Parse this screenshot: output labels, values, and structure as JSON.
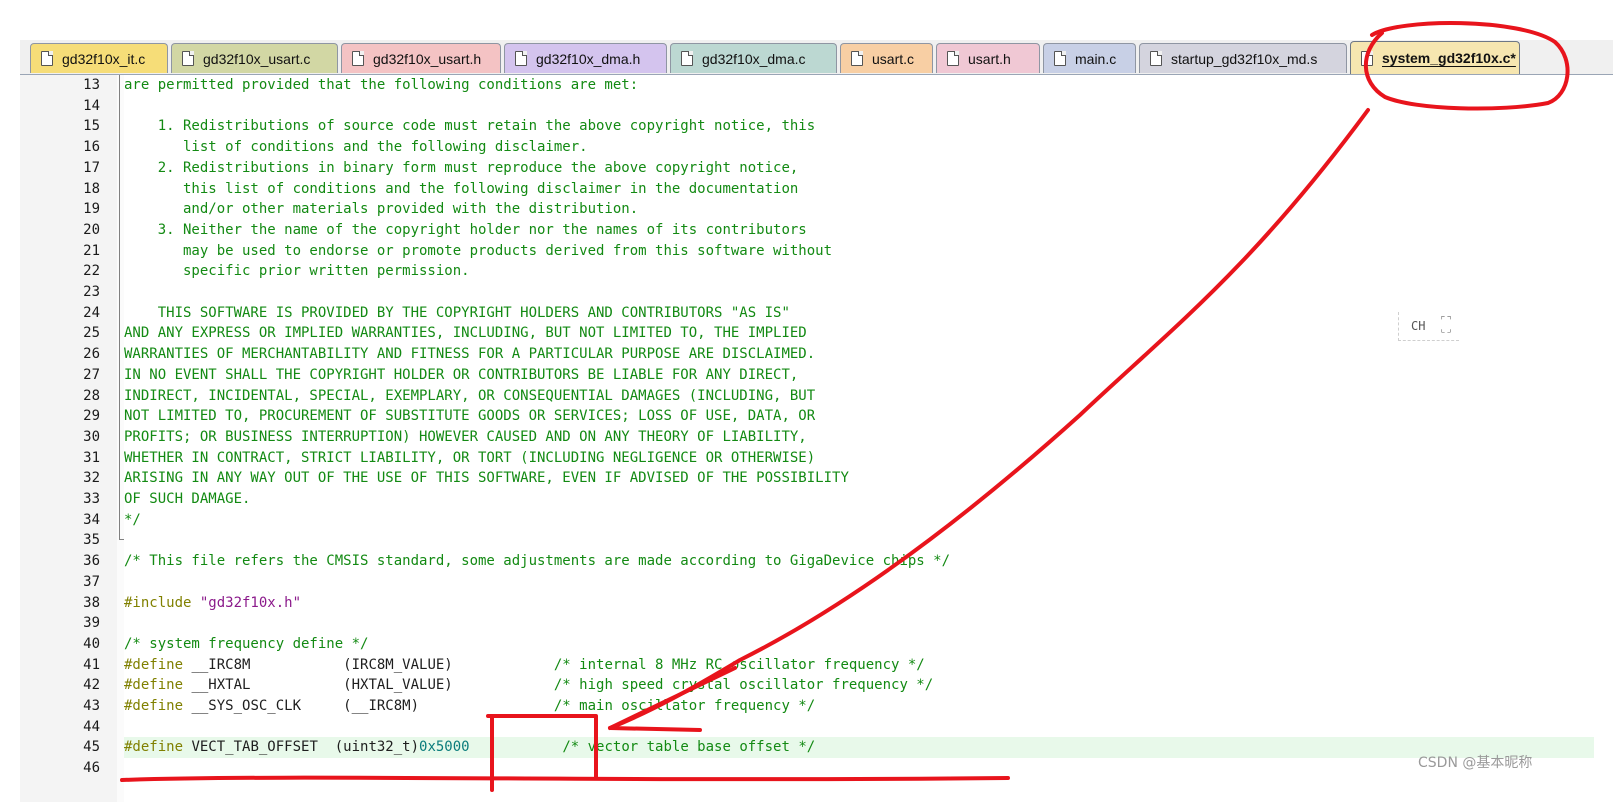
{
  "tabs": [
    {
      "label": "gd32f10x_it.c",
      "color": "#f6dd78",
      "active": false
    },
    {
      "label": "gd32f10x_usart.c",
      "color": "#d2d7a4",
      "active": false
    },
    {
      "label": "gd32f10x_usart.h",
      "color": "#f4c3c4",
      "active": false
    },
    {
      "label": "gd32f10x_dma.h",
      "color": "#d4c4ee",
      "active": false
    },
    {
      "label": "gd32f10x_dma.c",
      "color": "#bcd8d2",
      "active": false
    },
    {
      "label": "usart.c",
      "color": "#f8cfa4",
      "active": false
    },
    {
      "label": "usart.h",
      "color": "#f0c8d4",
      "active": false
    },
    {
      "label": "main.c",
      "color": "#c8d0e6",
      "active": false
    },
    {
      "label": "startup_gd32f10x_md.s",
      "color": "#d4d4de",
      "active": false
    },
    {
      "label": "system_gd32f10x.c*",
      "color": "#f6e6b0",
      "active": true
    }
  ],
  "lines": [
    {
      "num": "13",
      "parts": [
        {
          "t": "are permitted provided that the following conditions are met:",
          "c": "com"
        }
      ]
    },
    {
      "num": "14",
      "parts": []
    },
    {
      "num": "15",
      "parts": [
        {
          "t": "    1. Redistributions of source code must retain the above copyright notice, this",
          "c": "com"
        }
      ]
    },
    {
      "num": "16",
      "parts": [
        {
          "t": "       list of conditions and the following disclaimer.",
          "c": "com"
        }
      ]
    },
    {
      "num": "17",
      "parts": [
        {
          "t": "    2. Redistributions in binary form must reproduce the above copyright notice,",
          "c": "com"
        }
      ]
    },
    {
      "num": "18",
      "parts": [
        {
          "t": "       this list of conditions and the following disclaimer in the documentation",
          "c": "com"
        }
      ]
    },
    {
      "num": "19",
      "parts": [
        {
          "t": "       and/or other materials provided with the distribution.",
          "c": "com"
        }
      ]
    },
    {
      "num": "20",
      "parts": [
        {
          "t": "    3. Neither the name of the copyright holder nor the names of its contributors",
          "c": "com"
        }
      ]
    },
    {
      "num": "21",
      "parts": [
        {
          "t": "       may be used to endorse or promote products derived from this software without",
          "c": "com"
        }
      ]
    },
    {
      "num": "22",
      "parts": [
        {
          "t": "       specific prior written permission.",
          "c": "com"
        }
      ]
    },
    {
      "num": "23",
      "parts": []
    },
    {
      "num": "24",
      "parts": [
        {
          "t": "    THIS SOFTWARE IS PROVIDED BY THE COPYRIGHT HOLDERS AND CONTRIBUTORS \"AS IS\"",
          "c": "com"
        }
      ]
    },
    {
      "num": "25",
      "parts": [
        {
          "t": "AND ANY EXPRESS OR IMPLIED WARRANTIES, INCLUDING, BUT NOT LIMITED TO, THE IMPLIED",
          "c": "com"
        }
      ]
    },
    {
      "num": "26",
      "parts": [
        {
          "t": "WARRANTIES OF MERCHANTABILITY AND FITNESS FOR A PARTICULAR PURPOSE ARE DISCLAIMED.",
          "c": "com"
        }
      ]
    },
    {
      "num": "27",
      "parts": [
        {
          "t": "IN NO EVENT SHALL THE COPYRIGHT HOLDER OR CONTRIBUTORS BE LIABLE FOR ANY DIRECT,",
          "c": "com"
        }
      ]
    },
    {
      "num": "28",
      "parts": [
        {
          "t": "INDIRECT, INCIDENTAL, SPECIAL, EXEMPLARY, OR CONSEQUENTIAL DAMAGES (INCLUDING, BUT",
          "c": "com"
        }
      ]
    },
    {
      "num": "29",
      "parts": [
        {
          "t": "NOT LIMITED TO, PROCUREMENT OF SUBSTITUTE GOODS OR SERVICES; LOSS OF USE, DATA, OR",
          "c": "com"
        }
      ]
    },
    {
      "num": "30",
      "parts": [
        {
          "t": "PROFITS; OR BUSINESS INTERRUPTION) HOWEVER CAUSED AND ON ANY THEORY OF LIABILITY,",
          "c": "com"
        }
      ]
    },
    {
      "num": "31",
      "parts": [
        {
          "t": "WHETHER IN CONTRACT, STRICT LIABILITY, OR TORT (INCLUDING NEGLIGENCE OR OTHERWISE)",
          "c": "com"
        }
      ]
    },
    {
      "num": "32",
      "parts": [
        {
          "t": "ARISING IN ANY WAY OUT OF THE USE OF THIS SOFTWARE, EVEN IF ADVISED OF THE POSSIBILITY",
          "c": "com"
        }
      ]
    },
    {
      "num": "33",
      "parts": [
        {
          "t": "OF SUCH DAMAGE.",
          "c": "com"
        }
      ]
    },
    {
      "num": "34",
      "parts": [
        {
          "t": "*/",
          "c": "com"
        }
      ]
    },
    {
      "num": "35",
      "parts": []
    },
    {
      "num": "36",
      "parts": [
        {
          "t": "/* This file refers the CMSIS standard, some adjustments are made according to GigaDevice chips */",
          "c": "com"
        }
      ]
    },
    {
      "num": "37",
      "parts": []
    },
    {
      "num": "38",
      "parts": [
        {
          "t": "#include ",
          "c": "pre"
        },
        {
          "t": "\"gd32f10x.h\"",
          "c": "str"
        }
      ]
    },
    {
      "num": "39",
      "parts": []
    },
    {
      "num": "40",
      "parts": [
        {
          "t": "/* system frequency define */",
          "c": "com"
        }
      ]
    },
    {
      "num": "41",
      "parts": [
        {
          "t": "#define ",
          "c": "pre"
        },
        {
          "t": "__IRC8M           (IRC8M_VALUE)            ",
          "c": "txt"
        },
        {
          "t": "/* internal 8 MHz RC oscillator frequency */",
          "c": "com"
        }
      ]
    },
    {
      "num": "42",
      "parts": [
        {
          "t": "#define ",
          "c": "pre"
        },
        {
          "t": "__HXTAL           (HXTAL_VALUE)            ",
          "c": "txt"
        },
        {
          "t": "/* high speed crystal oscillator frequency */",
          "c": "com"
        }
      ]
    },
    {
      "num": "43",
      "parts": [
        {
          "t": "#define ",
          "c": "pre"
        },
        {
          "t": "__SYS_OSC_CLK     (__IRC8M)                ",
          "c": "txt"
        },
        {
          "t": "/* main oscillator frequency */",
          "c": "com"
        }
      ]
    },
    {
      "num": "44",
      "parts": []
    },
    {
      "num": "45",
      "parts": [
        {
          "t": "#define ",
          "c": "pre"
        },
        {
          "t": "VECT_TAB_OFFSET  (uint32_t)",
          "c": "txt"
        },
        {
          "t": "0x5000",
          "c": "num"
        },
        {
          "t": "           ",
          "c": "txt"
        },
        {
          "t": "/* vector table base offset */",
          "c": "com"
        }
      ],
      "highlight": true
    },
    {
      "num": "46",
      "parts": []
    }
  ],
  "ime_indicator": "CH",
  "ime_icon": "ime-mode-icon",
  "watermark": "CSDN @基本昵称",
  "annotation_color": "#e8141c"
}
